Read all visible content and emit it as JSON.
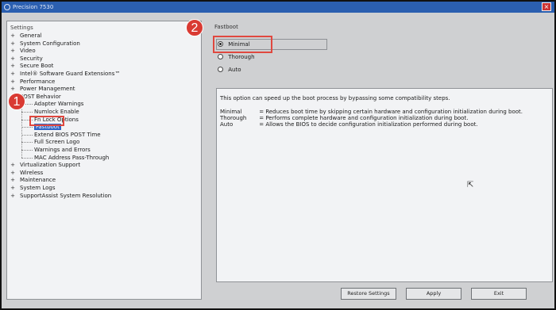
{
  "window": {
    "title": "Precision 7530"
  },
  "left_panel": {
    "root_label": "Settings",
    "tree": [
      {
        "label": "General",
        "level": 0,
        "expander": "+"
      },
      {
        "label": "System Configuration",
        "level": 0,
        "expander": "+"
      },
      {
        "label": "Video",
        "level": 0,
        "expander": "+"
      },
      {
        "label": "Security",
        "level": 0,
        "expander": "+"
      },
      {
        "label": "Secure Boot",
        "level": 0,
        "expander": "+"
      },
      {
        "label": "Intel® Software Guard Extensions™",
        "level": 0,
        "expander": "+"
      },
      {
        "label": "Performance",
        "level": 0,
        "expander": "+"
      },
      {
        "label": "Power Management",
        "level": 0,
        "expander": "+"
      },
      {
        "label": "POST Behavior",
        "level": 0,
        "expander": "-"
      },
      {
        "label": "Adapter Warnings",
        "level": 1,
        "expander": ""
      },
      {
        "label": "Numlock Enable",
        "level": 1,
        "expander": ""
      },
      {
        "label": "Fn Lock Options",
        "level": 1,
        "expander": ""
      },
      {
        "label": "Fastboot",
        "level": 1,
        "expander": "",
        "selected": true
      },
      {
        "label": "Extend BIOS POST Time",
        "level": 1,
        "expander": ""
      },
      {
        "label": "Full Screen Logo",
        "level": 1,
        "expander": ""
      },
      {
        "label": "Warnings and Errors",
        "level": 1,
        "expander": ""
      },
      {
        "label": "MAC Address Pass-Through",
        "level": 1,
        "expander": ""
      },
      {
        "label": "Virtualization Support",
        "level": 0,
        "expander": "+"
      },
      {
        "label": "Wireless",
        "level": 0,
        "expander": "+"
      },
      {
        "label": "Maintenance",
        "level": 0,
        "expander": "+"
      },
      {
        "label": "System Logs",
        "level": 0,
        "expander": "+"
      },
      {
        "label": "SupportAssist System Resolution",
        "level": 0,
        "expander": "+"
      }
    ]
  },
  "right_panel": {
    "group_label": "Fastboot",
    "options": [
      {
        "label": "Minimal",
        "checked": true
      },
      {
        "label": "Thorough",
        "checked": false
      },
      {
        "label": "Auto",
        "checked": false
      }
    ],
    "description": {
      "intro": "This option can speed up the boot process by bypassing some compatibility steps.",
      "rows": [
        {
          "term": "Minimal",
          "text": "= Reduces boot time by skipping certain hardware and configuration initialization during boot."
        },
        {
          "term": "Thorough",
          "text": "= Performs complete hardware and configuration initialization during boot."
        },
        {
          "term": "Auto",
          "text": "= Allows the BIOS to decide configuration initialization performed during boot."
        }
      ]
    }
  },
  "buttons": {
    "restore": "Restore Settings",
    "apply": "Apply",
    "exit": "Exit"
  },
  "annotations": {
    "marker_1": "1",
    "marker_2": "2",
    "color": "#d93a33"
  },
  "colors": {
    "titlebar": "#2b5fb0",
    "selection": "#2f64c4"
  }
}
